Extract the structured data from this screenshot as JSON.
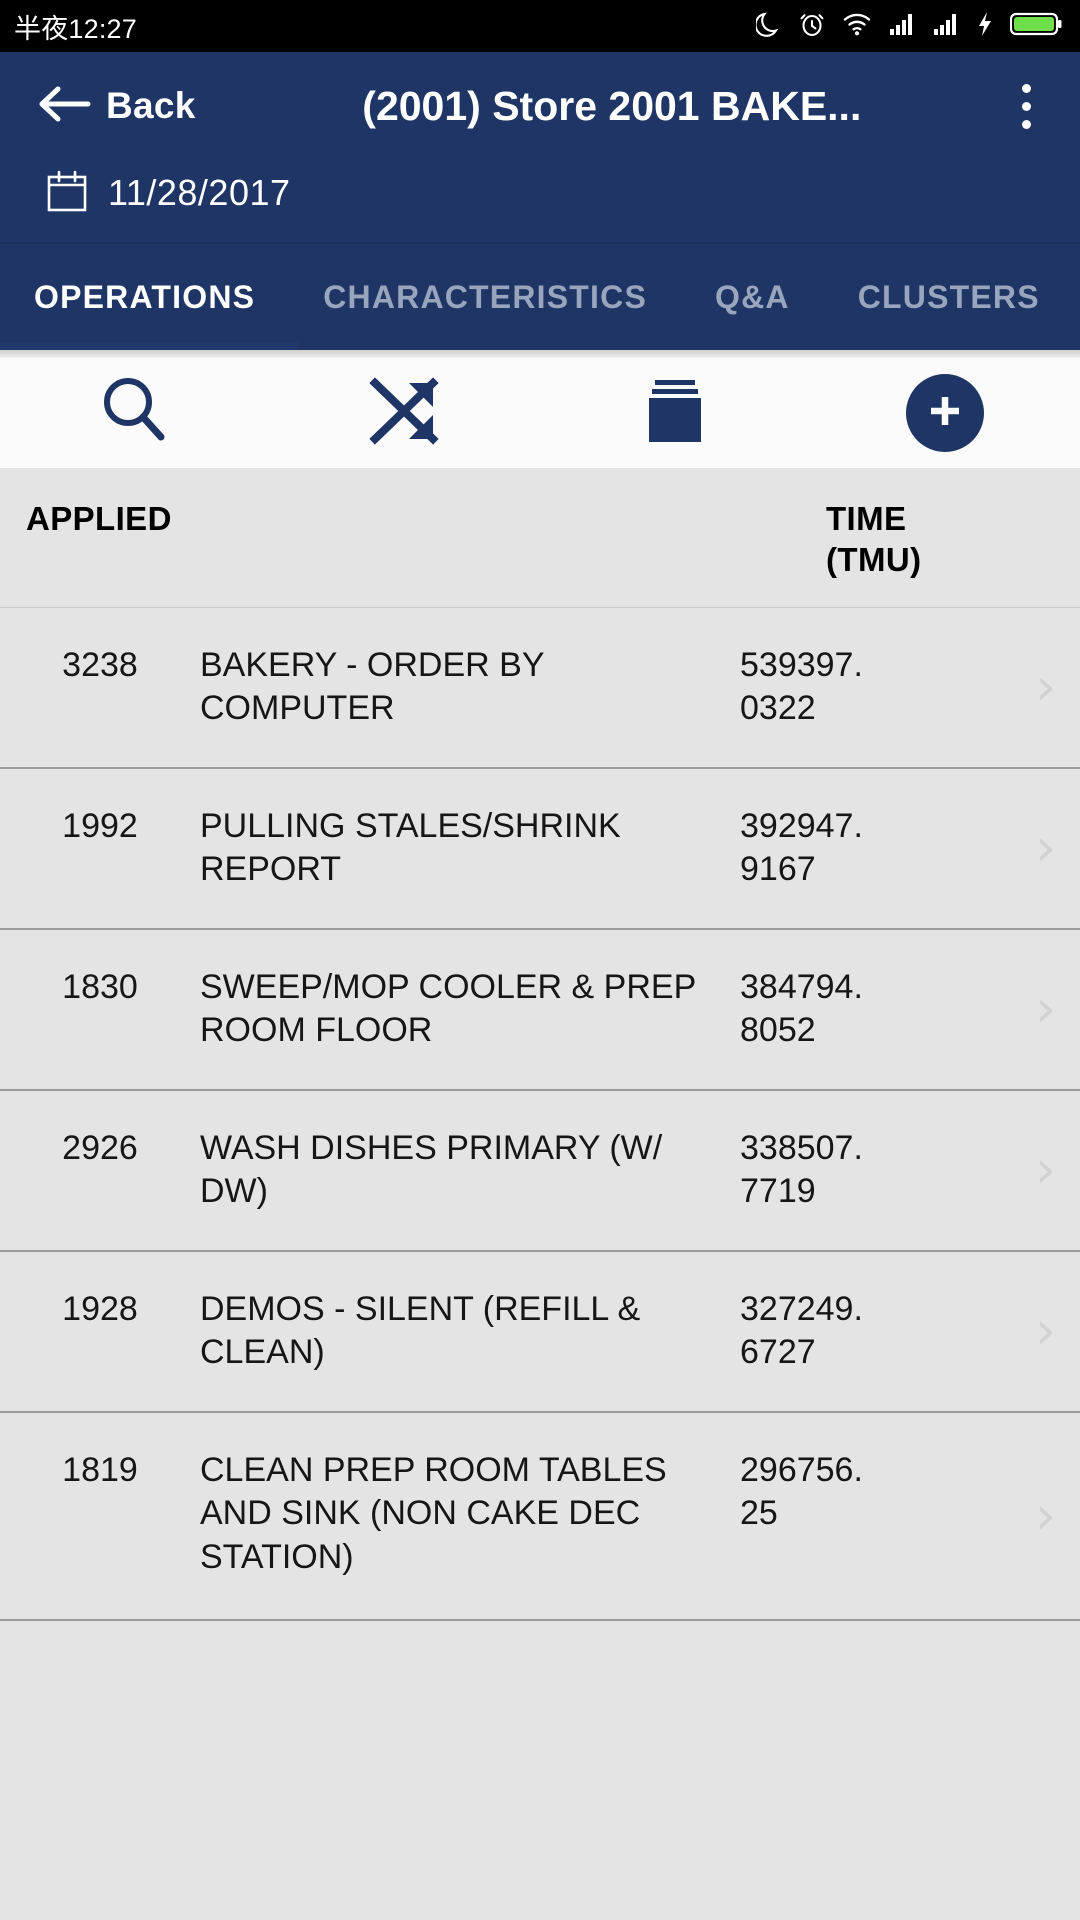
{
  "statusbar": {
    "time": "半夜12:27",
    "icons": [
      "moon-icon",
      "alarm-icon",
      "wifi-icon",
      "signal-sim1-icon",
      "signal-sim2-icon",
      "charging-bolt-icon",
      "battery-icon"
    ],
    "battery_color": "#6fe04a",
    "background": "#000000"
  },
  "appbar": {
    "back_label": "Back",
    "back_icon": "arrow-left-icon",
    "title": "(2001) Store 2001   BAKE...",
    "overflow_icon": "more-vertical-icon",
    "calendar_icon": "calendar-icon",
    "date": "11/28/2017",
    "background": "#1e3565"
  },
  "tabs": {
    "items": [
      {
        "label": "OPERATIONS",
        "active": true
      },
      {
        "label": "CHARACTERISTICS",
        "active": false
      },
      {
        "label": "Q&A",
        "active": false
      },
      {
        "label": "CLUSTERS",
        "active": false
      }
    ],
    "active_color": "#ffffff",
    "inactive_color": "#98a5bd"
  },
  "toolbar": {
    "items": [
      {
        "name": "search-icon",
        "label": "Search"
      },
      {
        "name": "shuffle-icon",
        "label": "Shuffle"
      },
      {
        "name": "folder-stack-icon",
        "label": "Library"
      },
      {
        "name": "add-icon",
        "label": "Add"
      }
    ],
    "accent": "#1e3565"
  },
  "table": {
    "headers": {
      "applied": "APPLIED",
      "description": "",
      "time_line1": "TIME",
      "time_line2": "(TMU)"
    },
    "chevron": "›",
    "rows": [
      {
        "applied": "3238",
        "description": "BAKERY - ORDER BY COMPUTER",
        "time_line1": "539397.",
        "time_line2": "0322"
      },
      {
        "applied": "1992",
        "description": "PULLING STALES/SHRINK REPORT",
        "time_line1": "392947.",
        "time_line2": "9167"
      },
      {
        "applied": "1830",
        "description": "SWEEP/MOP COOLER & PREP ROOM FLOOR",
        "time_line1": "384794.",
        "time_line2": "8052"
      },
      {
        "applied": "2926",
        "description": "WASH DISHES PRIMARY (W/ DW)",
        "time_line1": "338507.",
        "time_line2": "7719"
      },
      {
        "applied": "1928",
        "description": "DEMOS - SILENT (REFILL & CLEAN)",
        "time_line1": "327249.",
        "time_line2": "6727"
      },
      {
        "applied": "1819",
        "description": "CLEAN PREP ROOM TABLES AND SINK (NON CAKE DEC STATION)",
        "time_line1": "296756.",
        "time_line2": "25"
      }
    ]
  }
}
